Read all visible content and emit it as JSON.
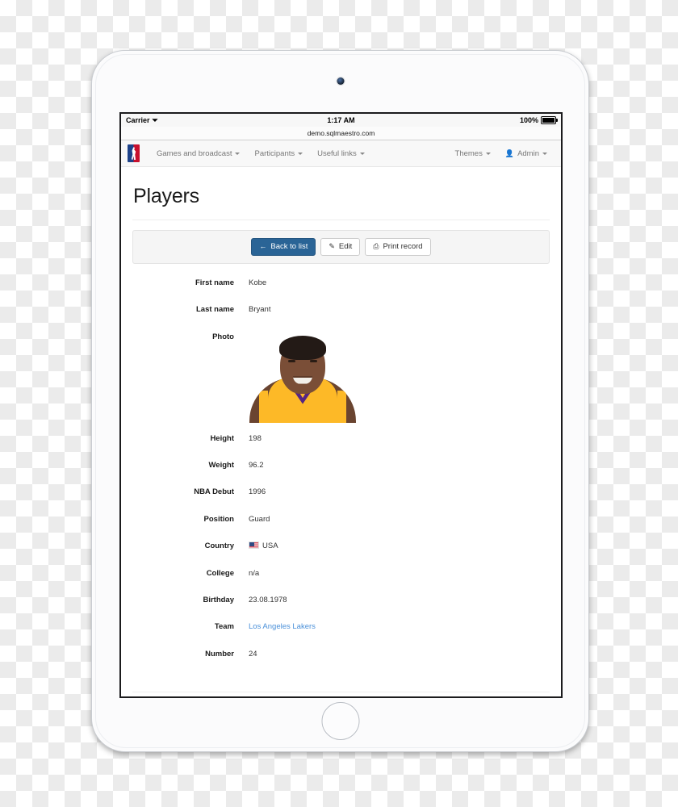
{
  "status_bar": {
    "carrier": "Carrier",
    "wifi_icon": "wifi-icon",
    "time": "1:17 AM",
    "battery_percent": "100%",
    "battery_icon": "battery-full-icon"
  },
  "browser": {
    "url": "demo.sqlmaestro.com"
  },
  "navbar": {
    "brand_icon": "nba-logo-icon",
    "items": [
      {
        "label": "Games and broadcast",
        "caret": true
      },
      {
        "label": "Participants",
        "caret": true
      },
      {
        "label": "Useful links",
        "caret": true
      }
    ],
    "right_items": [
      {
        "label": "Themes",
        "caret": true,
        "icon": ""
      },
      {
        "label": "Admin",
        "caret": true,
        "icon": "user-icon"
      }
    ]
  },
  "page": {
    "title": "Players"
  },
  "toolbar": {
    "back_label": "Back to list",
    "back_icon": "arrow-left-icon",
    "edit_label": "Edit",
    "edit_icon": "pencil-icon",
    "print_label": "Print record",
    "print_icon": "printer-icon"
  },
  "record": {
    "fields": [
      {
        "label": "First name",
        "value": "Kobe",
        "type": "text"
      },
      {
        "label": "Last name",
        "value": "Bryant",
        "type": "text"
      },
      {
        "label": "Photo",
        "value": "",
        "type": "photo"
      },
      {
        "label": "Height",
        "value": "198",
        "type": "text"
      },
      {
        "label": "Weight",
        "value": "96.2",
        "type": "text"
      },
      {
        "label": "NBA Debut",
        "value": "1996",
        "type": "text"
      },
      {
        "label": "Position",
        "value": "Guard",
        "type": "text"
      },
      {
        "label": "Country",
        "value": "USA",
        "type": "flag"
      },
      {
        "label": "College",
        "value": "n/a",
        "type": "text"
      },
      {
        "label": "Birthday",
        "value": "23.08.1978",
        "type": "text"
      },
      {
        "label": "Team",
        "value": "Los Angeles Lakers",
        "type": "link"
      },
      {
        "label": "Number",
        "value": "24",
        "type": "text"
      }
    ],
    "photo_alt": "player-headshot"
  },
  "colors": {
    "primary_button": "#2a6496",
    "link": "#4a90d9",
    "nba_blue": "#1d428a",
    "nba_red": "#c8102e",
    "jersey_gold": "#fdb927",
    "jersey_purple": "#552583"
  }
}
